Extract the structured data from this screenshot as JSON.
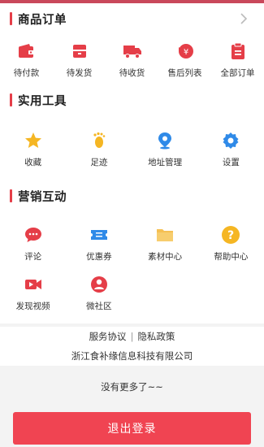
{
  "orders": {
    "title": "商品订单",
    "items": [
      {
        "label": "待付款",
        "icon": "wallet-icon"
      },
      {
        "label": "待发货",
        "icon": "box-icon"
      },
      {
        "label": "待收货",
        "icon": "truck-icon"
      },
      {
        "label": "售后列表",
        "icon": "refund-icon"
      },
      {
        "label": "全部订单",
        "icon": "clipboard-icon"
      }
    ]
  },
  "tools": {
    "title": "实用工具",
    "items": [
      {
        "label": "收藏",
        "icon": "star-icon"
      },
      {
        "label": "足迹",
        "icon": "footprint-icon"
      },
      {
        "label": "地址管理",
        "icon": "location-icon"
      },
      {
        "label": "设置",
        "icon": "gear-icon"
      }
    ]
  },
  "marketing": {
    "title": "营销互动",
    "items": [
      {
        "label": "评论",
        "icon": "comment-icon"
      },
      {
        "label": "优惠券",
        "icon": "coupon-icon"
      },
      {
        "label": "素材中心",
        "icon": "folder-icon"
      },
      {
        "label": "帮助中心",
        "icon": "help-icon"
      },
      {
        "label": "发现视频",
        "icon": "video-icon"
      },
      {
        "label": "微社区",
        "icon": "community-icon"
      }
    ]
  },
  "footer": {
    "service": "服务协议",
    "separator": "|",
    "privacy": "隐私政策",
    "company": "浙江食补缘信息科技有限公司"
  },
  "more_text": "没有更多了~~",
  "logout_label": "退出登录",
  "colors": {
    "accent": "#e53e48",
    "button": "#f04452",
    "blue": "#2f8ae8",
    "yellow": "#f5b623"
  }
}
